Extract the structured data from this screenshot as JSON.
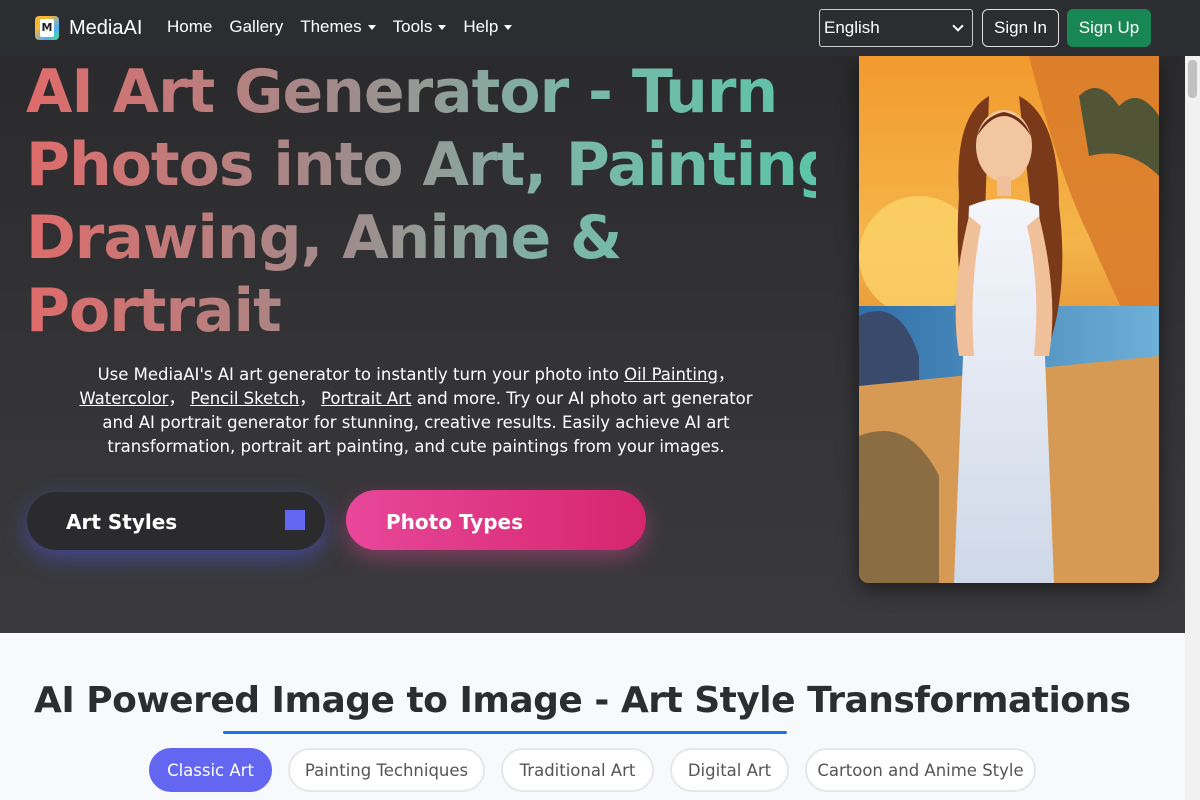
{
  "navbar": {
    "brand": "MediaAI",
    "logo_letter": "M",
    "links": [
      {
        "label": "Home",
        "dropdown": false
      },
      {
        "label": "Gallery",
        "dropdown": false
      },
      {
        "label": "Themes",
        "dropdown": true
      },
      {
        "label": "Tools",
        "dropdown": true
      },
      {
        "label": "Help",
        "dropdown": true
      }
    ],
    "language": "English",
    "sign_in": "Sign In",
    "sign_up": "Sign Up"
  },
  "hero": {
    "title_lines": [
      "AI Art Generator - Turn",
      "Photos into Art, Painting,",
      "Drawing, Anime &",
      "Portrait"
    ],
    "desc_part1": "Use MediaAI's AI art generator to instantly turn your photo into ",
    "link_oil": "Oil Painting",
    "sep1": "， ",
    "link_watercolor": "Watercolor",
    "sep2": "， ",
    "link_pencil": "Pencil Sketch",
    "sep3": "， ",
    "link_portrait": "Portrait Art",
    "desc_part2": " and more. Try our AI photo art generator and AI portrait generator for stunning, creative results. Easily achieve AI art transformation, portrait art painting, and cute paintings from your images.",
    "btn_art_styles": "Art Styles",
    "btn_photo_types": "Photo Types"
  },
  "section": {
    "title": "AI Powered Image to Image - Art Style Transformations",
    "tabs": [
      "Classic Art",
      "Painting Techniques",
      "Traditional Art",
      "Digital Art",
      "Cartoon and Anime Style"
    ],
    "active_tab": 0
  },
  "colors": {
    "navbar_bg": "#2b2d31",
    "sign_up_bg": "#198754",
    "active_tab": "#6366f1",
    "photo_types_gradient": [
      "#e8479a",
      "#d6266e"
    ],
    "underline": "#1a73e8"
  }
}
